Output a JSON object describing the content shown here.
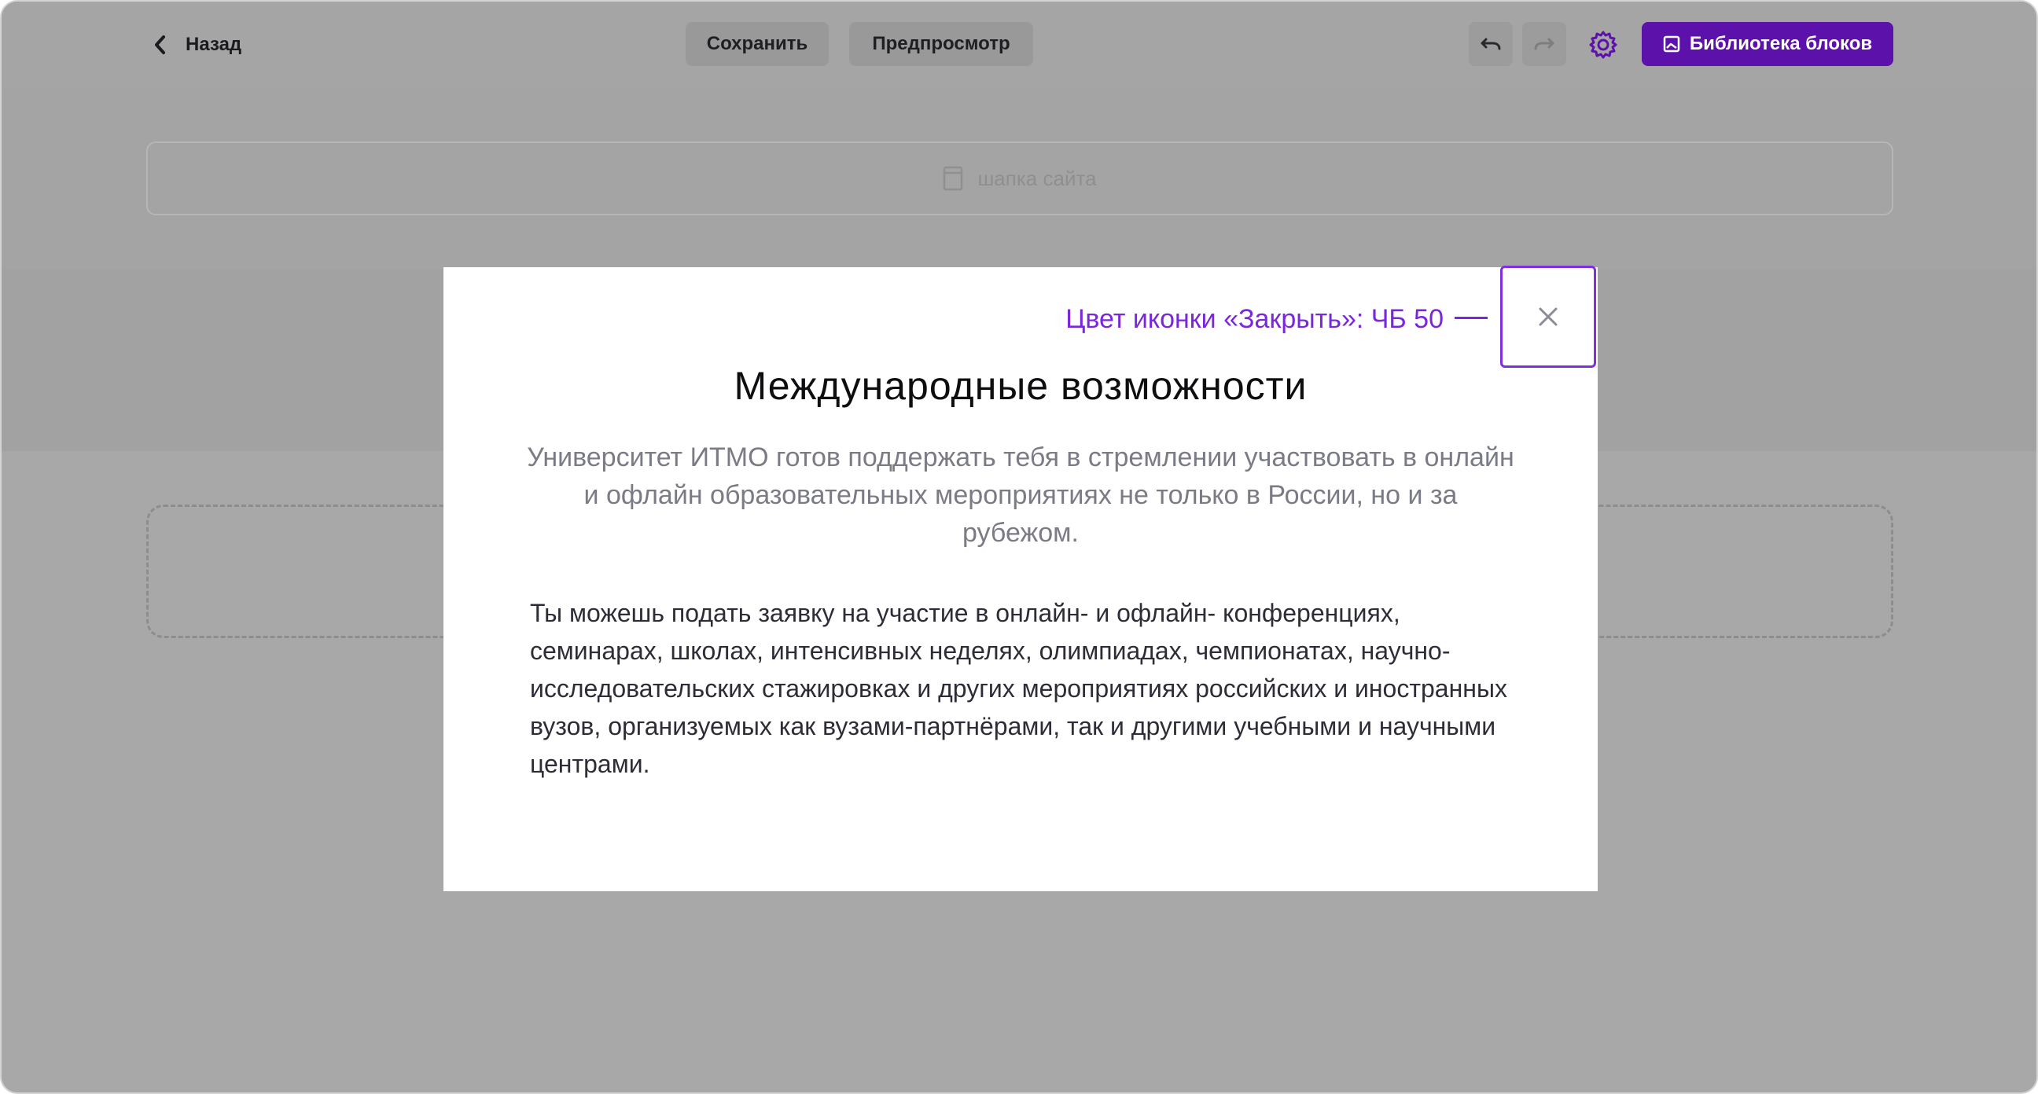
{
  "toolbar": {
    "back_label": "Назад",
    "save_label": "Сохранить",
    "preview_label": "Предпросмотр",
    "library_label": "Библиотека блоков",
    "accent_color": "#5d11ab"
  },
  "canvas": {
    "header_block_label": "шапка сайта"
  },
  "modal": {
    "title": "Международные возможности",
    "lead": "Университет ИТМО готов поддержать тебя в стремлении участвовать в онлайн и офлайн образовательных мероприятиях не только в России, но и за рубежом.",
    "body": "Ты можешь подать заявку на участие в онлайн- и офлайн- конференциях, семинарах, школах, интенсивных неделях, олимпиадах, чемпионатах, научно-исследовательских стажировках и других мероприятиях российских и иностранных вузов, организуемых как вузами-партнёрами, так и другими учебными и научными центрами.",
    "close_annotation": "Цвет иконки «Закрыть»: ЧБ 50",
    "annotation_color": "#7a26dc"
  },
  "icons": {
    "back": "chevron-left-icon",
    "undo": "undo-icon",
    "redo": "redo-icon",
    "settings": "gear-icon",
    "library": "image-icon",
    "header_block": "page-icon",
    "close": "close-icon"
  }
}
